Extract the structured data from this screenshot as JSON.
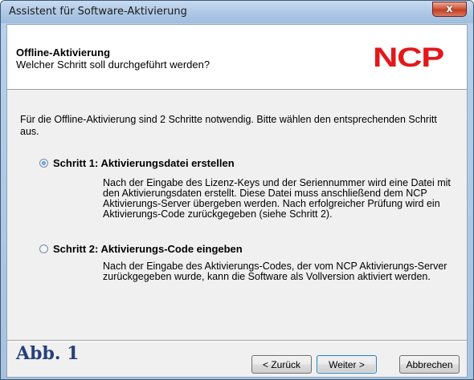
{
  "window": {
    "title": "Assistent für Software-Aktivierung",
    "close_glyph": "x"
  },
  "header": {
    "title": "Offline-Aktivierung",
    "subtitle": "Welcher Schritt soll durchgeführt werden?",
    "logo_text": "NCP",
    "logo_color": "#e3181b"
  },
  "intro": "Für die Offline-Aktivierung sind 2 Schritte notwendig. Bitte wählen den entsprechenden Schritt aus.",
  "options": [
    {
      "label": "Schritt 1:  Aktivierungsdatei erstellen",
      "selected": true,
      "description": "Nach der Eingabe des Lizenz-Keys und der Seriennummer wird eine Datei mit den Aktivierungsdaten erstellt. Diese Datei muss anschließend dem NCP Aktivierungs-Server übergeben werden. Nach erfolgreicher Prüfung wird ein Aktivierungs-Code zurückgegeben (siehe Schritt 2)."
    },
    {
      "label": "Schritt 2:  Aktivierungs-Code eingeben",
      "selected": false,
      "description": "Nach der Eingabe des Aktivierungs-Codes, der vom NCP Aktivierungs-Server zurückgegeben wurde, kann die Software als Vollversion aktiviert werden."
    }
  ],
  "figure_label": "Abb. 1",
  "buttons": {
    "back": "< Zurück",
    "next": "Weiter >",
    "cancel": "Abbrechen"
  }
}
